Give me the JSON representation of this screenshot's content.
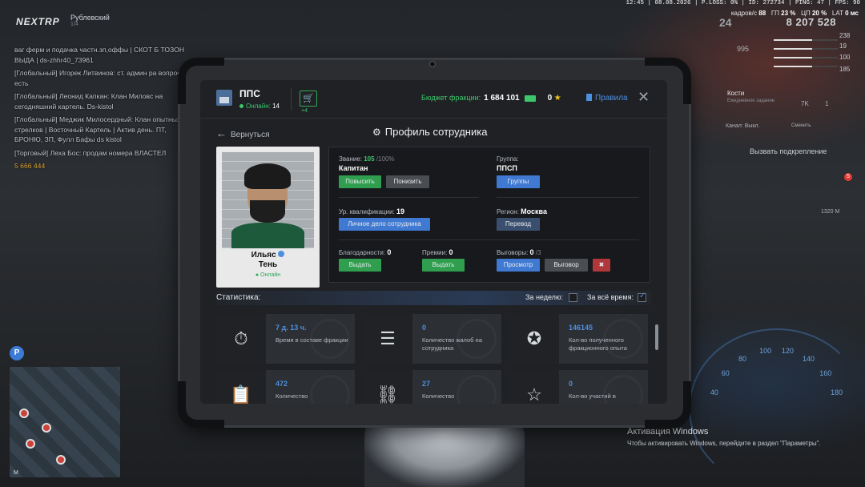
{
  "hud": {
    "logo": "NEXTRP",
    "server": "Рублевский",
    "server_sub": "1/4",
    "topline": "12:45 | 08.08.2026 | P.LOSS: 0% | ID: 272734 | PING: 47 | FPS: 90",
    "fps_label": "кадров/с",
    "fps_value": "88",
    "gpu_label": "ГП",
    "gpu_value": "23 %",
    "cpu_label": "ЦП",
    "cpu_value": "20 %",
    "lat_label": "LAT",
    "lat_value": "0 мс",
    "big_number": "24",
    "money": "8 207 528",
    "stat1": "238",
    "stat2": "19",
    "stat3": "100",
    "stat4": "185",
    "price": "995",
    "dice_title": "Кости",
    "dice_sub": "Ежедневное задание",
    "counter1": "7K",
    "counter2": "1",
    "channel": "Канал: Выкл.",
    "change": "Сменить",
    "backup": "Вызвать подкрепление",
    "distance": "1320 М",
    "notif": "5",
    "map_p": "P",
    "map_m": "M",
    "speed_ticks": [
      "40",
      "60",
      "80",
      "100",
      "120",
      "140",
      "160",
      "180"
    ],
    "windows_title": "Активация Windows",
    "windows_sub": "Чтобы активировать Windows, перейдите в раздел \"Параметры\"."
  },
  "chat": [
    {
      "text": "ваг ферм и подачка частн.зп,оффы | СКОТ Б ТОЗОН ВЫДА | ds-zhhr40_73961"
    },
    {
      "text": "[Глобальный] Игорек Литвинов: ст. админ ра вопрос есть"
    },
    {
      "text": "[Глобальный] Леонид Капкан: Клан Миловс на сегодняшний картель. Ds-kistol"
    },
    {
      "text": "[Глобальный] Меджик Милосердный: Клан опытных стрелков | Восточный Картель | Актив день. ПТ, БРОНЮ, ЗП, Фулл Бафы ds kistol"
    },
    {
      "text": "[Торговый] Леха Бос: продам номера ВЛАСТЕЛ"
    },
    {
      "text": "5 666 444",
      "money": true
    }
  ],
  "header": {
    "title": "ППС",
    "online_label": "Онлайн:",
    "online_count": "14",
    "cart_badge": "+4",
    "budget_label": "Бюджет фракции:",
    "budget_value": "1 684 101",
    "coins": "0",
    "rules_label": "Правила"
  },
  "nav": {
    "back_label": "Вернуться",
    "page_title": "Профиль сотрудника"
  },
  "profile": {
    "first_name": "Ильяс",
    "last_name": "Тень",
    "status": "Онлайн"
  },
  "info": {
    "rank_label": "Звание:",
    "rank_progress": "105",
    "rank_max": "/100%",
    "rank_name": "Капитан",
    "promote": "Повысить",
    "demote": "Понизить",
    "group_label": "Группа:",
    "group_name": "ППСП",
    "groups_button": "Группы",
    "qual_label": "Ур. квалификации:",
    "qual_value": "19",
    "personal_file": "Личное дело сотрудника",
    "region_label": "Регион:",
    "region_value": "Москва",
    "transfer": "Перевод",
    "thanks_label": "Благодарности:",
    "thanks_value": "0",
    "give1": "Выдать",
    "bonus_label": "Премии:",
    "bonus_value": "0",
    "give2": "Выдать",
    "reprimand_label": "Выговоры:",
    "reprimand_value": "0",
    "reprimand_max": "/3",
    "view": "Просмотр",
    "reprimand_btn": "Выговор"
  },
  "stats": {
    "label": "Статистика:",
    "week_label": "За неделю:",
    "week_checked": false,
    "all_label": "За всё время:",
    "all_checked": true,
    "tiles": [
      {
        "icon": "stopwatch-icon",
        "value": "7 д. 13 ч.",
        "text": "Время в составе фракции"
      },
      {
        "icon": "complaint-icon",
        "value": "0",
        "text": "Количество жалоб на сотрудника"
      },
      {
        "icon": "exp-badge-icon",
        "value": "146145",
        "text": "Кол-во полученного фракционного опыта"
      },
      {
        "icon": "clipboard-icon",
        "value": "472",
        "text": "Количество"
      },
      {
        "icon": "handcuffs-icon",
        "value": "27",
        "text": "Количество"
      },
      {
        "icon": "star-badge-icon",
        "value": "0",
        "text": "Кол-во участий в"
      }
    ]
  }
}
